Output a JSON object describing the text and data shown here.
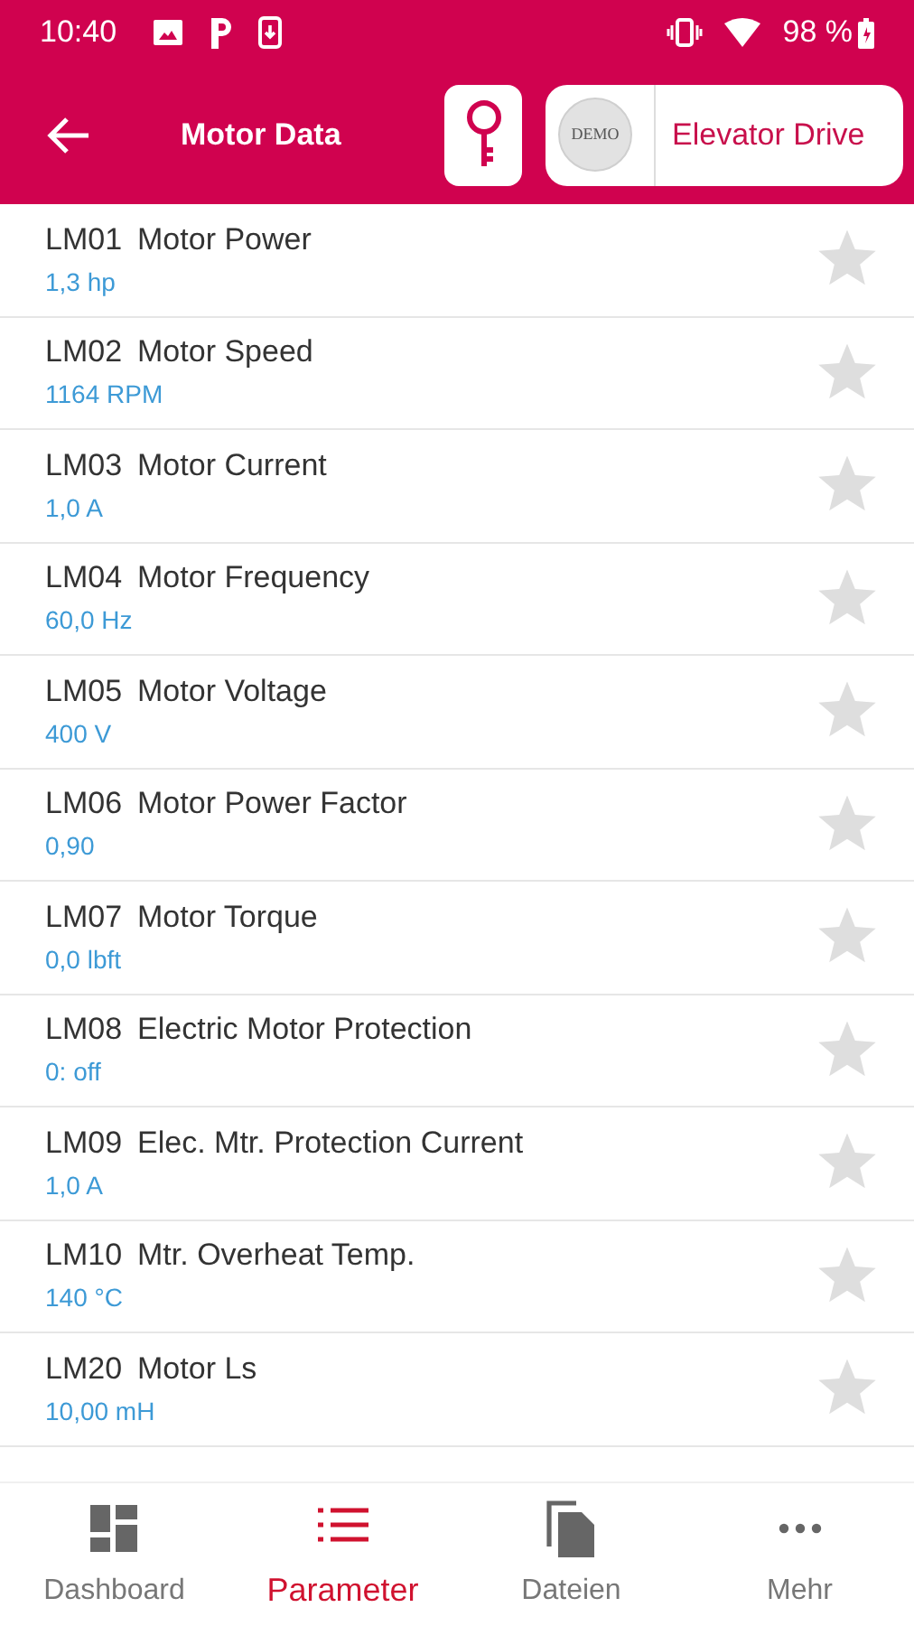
{
  "status_bar": {
    "time": "10:40",
    "battery": "98 %"
  },
  "app_bar": {
    "title": "Motor Data",
    "device_badge": "DEMO",
    "device_name": "Elevator Drive"
  },
  "parameters": [
    {
      "code": "LM01",
      "name": "Motor Power",
      "value": "1,3 hp",
      "favorite": false
    },
    {
      "code": "LM02",
      "name": "Motor Speed",
      "value": "1164 RPM",
      "favorite": false
    },
    {
      "code": "LM03",
      "name": "Motor Current",
      "value": "1,0 A",
      "favorite": false
    },
    {
      "code": "LM04",
      "name": "Motor Frequency",
      "value": "60,0 Hz",
      "favorite": false
    },
    {
      "code": "LM05",
      "name": "Motor Voltage",
      "value": "400 V",
      "favorite": false
    },
    {
      "code": "LM06",
      "name": "Motor Power Factor",
      "value": "0,90",
      "favorite": false
    },
    {
      "code": "LM07",
      "name": "Motor Torque",
      "value": "0,0 lbft",
      "favorite": false
    },
    {
      "code": "LM08",
      "name": "Electric Motor Protection",
      "value": "0: off",
      "favorite": false
    },
    {
      "code": "LM09",
      "name": "Elec. Mtr. Protection Current",
      "value": "1,0 A",
      "favorite": false
    },
    {
      "code": "LM10",
      "name": "Mtr. Overheat Temp.",
      "value": "140 °C",
      "favorite": false
    },
    {
      "code": "LM20",
      "name": "Motor Ls",
      "value": "10,00 mH",
      "favorite": false
    }
  ],
  "bottom_nav": [
    {
      "kind": "dashboard",
      "label": "Dashboard",
      "selected": false
    },
    {
      "kind": "list",
      "label": "Parameter",
      "selected": true
    },
    {
      "kind": "files",
      "label": "Dateien",
      "selected": false
    },
    {
      "kind": "more",
      "label": "Mehr",
      "selected": false
    }
  ]
}
